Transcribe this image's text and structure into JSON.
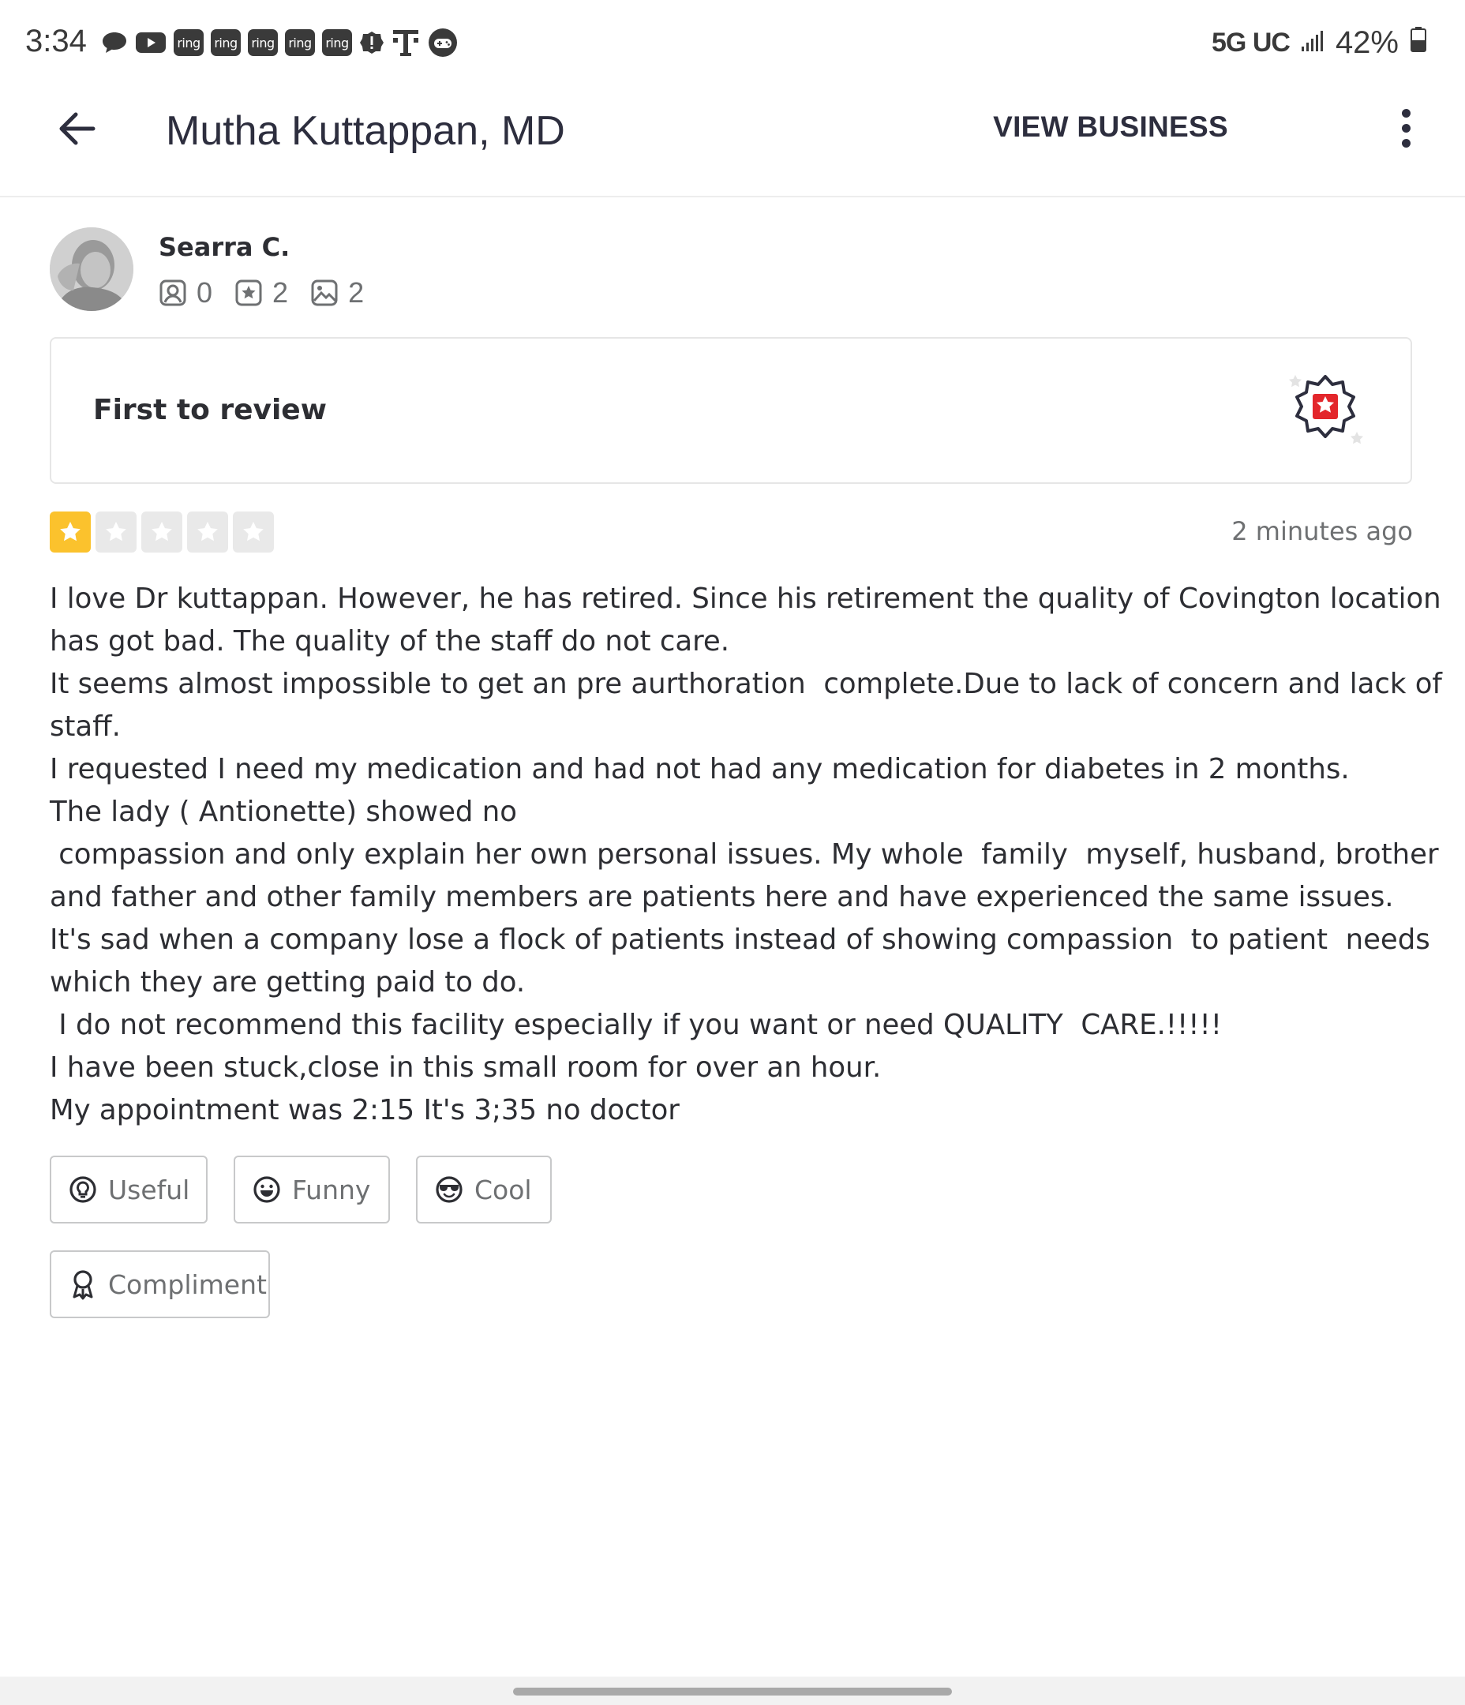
{
  "status_bar": {
    "time": "3:34",
    "ring_label": "ring",
    "network": "5G UC",
    "battery": "42%",
    "icons": [
      "message-icon",
      "youtube-icon",
      "ring-icon",
      "ring-icon",
      "ring-icon",
      "ring-icon",
      "ring-icon",
      "alert-icon",
      "t-mobile-icon",
      "game-icon",
      "signal-icon",
      "battery-icon"
    ]
  },
  "header": {
    "title": "Mutha Kuttappan, MD",
    "view_business_label": "VIEW BUSINESS",
    "back_icon": "arrow-left-icon",
    "more_icon": "more-vertical-icon"
  },
  "reviewer": {
    "name": "Searra C.",
    "friends_count": "0",
    "reviews_count": "2",
    "photos_count": "2"
  },
  "first_review_card": {
    "label": "First to review",
    "badge_icon": "first-to-review-badge-icon"
  },
  "review": {
    "rating": 1,
    "max_rating": 5,
    "timestamp": "2 minutes ago",
    "lines": [
      "I love Dr kuttappan. However, he has retired. Since his retirement the quality of Covington location",
      "has got bad. The quality of the staff do not care.",
      "It seems almost impossible to get an pre aurthoration  complete.Due to lack of concern and lack of",
      "staff.",
      "I requested I need my medication and had not had any medication for diabetes in 2 months.",
      "The lady ( Antionette) showed no",
      " compassion and only explain her own personal issues. My whole  family  myself, husband, brother",
      "and father and other family members are patients here and have experienced the same issues.",
      "It's sad when a company lose a flock of patients instead of showing compassion  to patient  needs",
      "which they are getting paid to do.",
      " I do not recommend this facility especially if you want or need QUALITY  CARE.!!!!!",
      "I have been stuck,close in this small room for over an hour.",
      "My appointment was 2:15 It's 3;35 no doctor"
    ]
  },
  "reactions": {
    "useful_label": "Useful",
    "funny_label": "Funny",
    "cool_label": "Cool",
    "compliment_label": "Compliment"
  },
  "colors": {
    "star_on": "#fbc22d",
    "star_off": "#e9e9e9",
    "badge_red": "#e3262b",
    "text_dark": "#2d2e33",
    "text_muted": "#6e7072"
  }
}
